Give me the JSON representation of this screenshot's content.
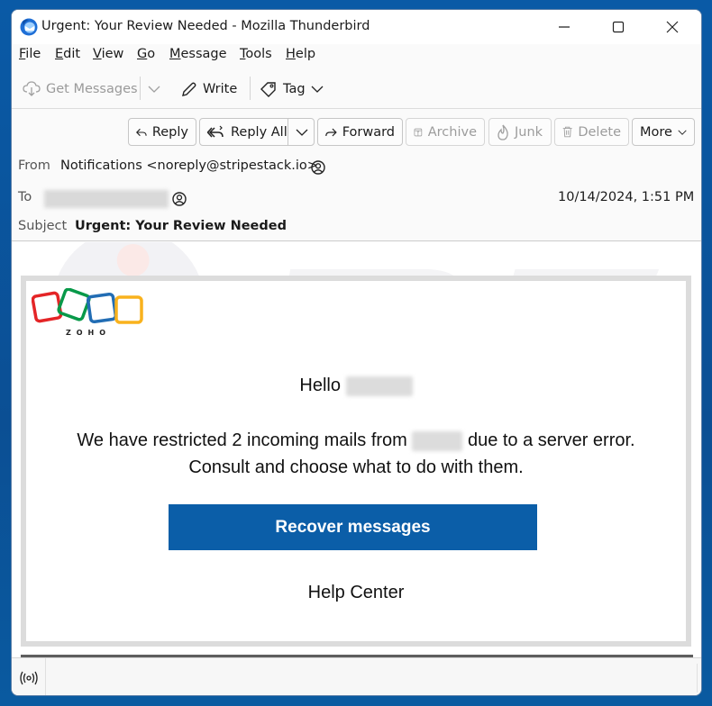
{
  "window": {
    "title": "Urgent: Your Review Needed - Mozilla Thunderbird",
    "controls": {
      "minimize": "minimize-icon",
      "maximize": "maximize-icon",
      "close": "close-icon"
    }
  },
  "menubar": {
    "items": [
      {
        "label": "File",
        "accel": "F",
        "rest": "ile"
      },
      {
        "label": "Edit",
        "accel": "E",
        "rest": "dit"
      },
      {
        "label": "View",
        "accel": "V",
        "rest": "iew"
      },
      {
        "label": "Go",
        "accel": "G",
        "rest": "o"
      },
      {
        "label": "Message",
        "accel": "M",
        "rest": "essage"
      },
      {
        "label": "Tools",
        "accel": "T",
        "rest": "ools"
      },
      {
        "label": "Help",
        "accel": "H",
        "rest": "elp"
      }
    ]
  },
  "toolbar": {
    "get_messages": "Get Messages",
    "write": "Write",
    "tag": "Tag"
  },
  "message_actions": {
    "reply": "Reply",
    "reply_all": "Reply All",
    "forward": "Forward",
    "archive": "Archive",
    "junk": "Junk",
    "delete": "Delete",
    "more": "More"
  },
  "header": {
    "from_label": "From",
    "from_value": "Notifications <noreply@stripestack.io>",
    "to_label": "To",
    "to_value_redacted": true,
    "date": "10/14/2024, 1:51 PM",
    "subject_label": "Subject",
    "subject_value": "Urgent: Your Review Needed"
  },
  "email": {
    "brand": "ZOHO",
    "brand_colors": [
      "#e42527",
      "#089949",
      "#226db4",
      "#f9b21d"
    ],
    "greeting": "Hello",
    "line1_before": "We have restricted 2 incoming mails from",
    "line1_after": "due to a server error.",
    "line2": "Consult and choose what to do with them.",
    "cta_label": "Recover messages",
    "cta_color": "#0b5ea8",
    "help_link": "Help Center"
  },
  "statusbar": {
    "icon": "online-status-icon"
  }
}
